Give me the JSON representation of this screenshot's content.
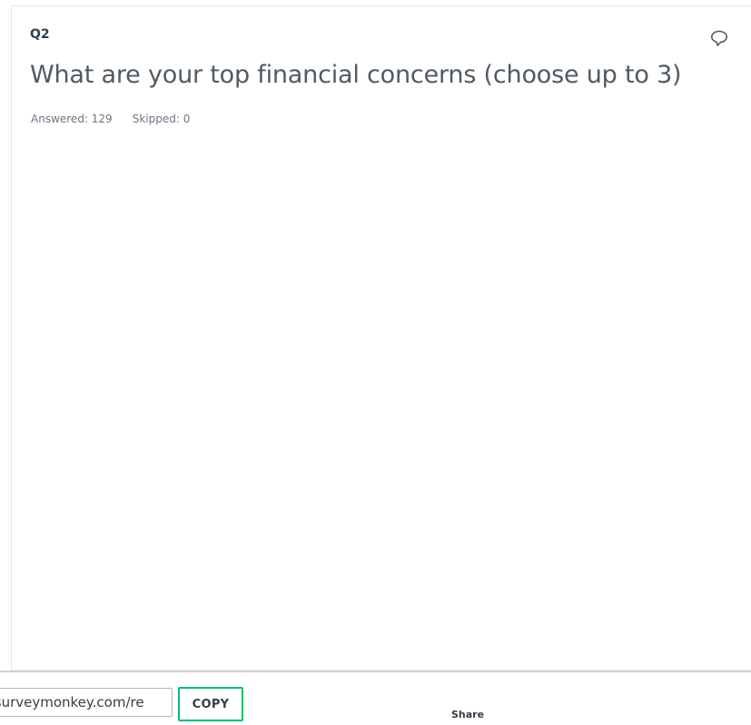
{
  "question": {
    "number": "Q2",
    "title": "What are your top financial concerns (choose up to 3)",
    "answered": "Answered: 129",
    "skipped": "Skipped: 0",
    "comment_icon": "speech-bubble-icon"
  },
  "share": {
    "url_value": ".surveymonkey.com/re",
    "copy_label": "COPY",
    "share_label": "Share"
  },
  "colors": {
    "accent": "#00bf6f",
    "text": "#333e48",
    "muted": "#6b7682"
  }
}
